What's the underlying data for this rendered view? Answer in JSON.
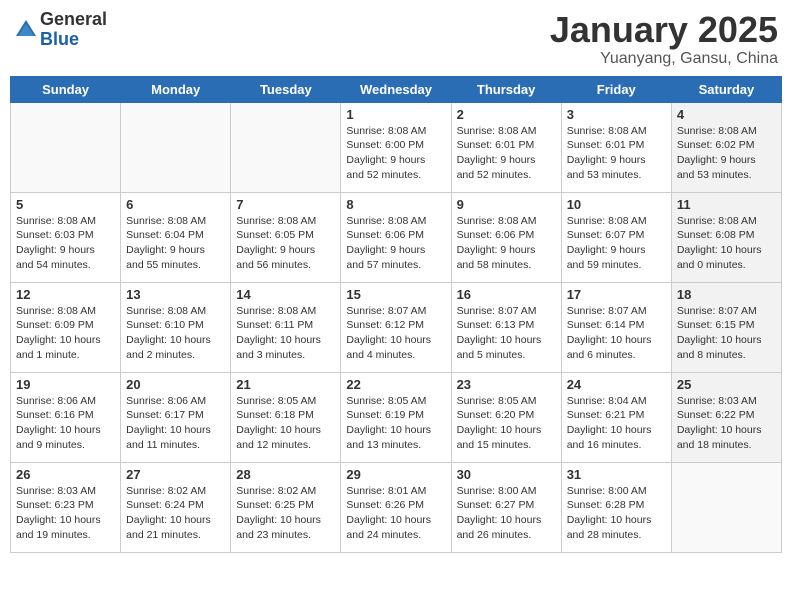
{
  "header": {
    "logo_general": "General",
    "logo_blue": "Blue",
    "title": "January 2025",
    "location": "Yuanyang, Gansu, China"
  },
  "days_of_week": [
    "Sunday",
    "Monday",
    "Tuesday",
    "Wednesday",
    "Thursday",
    "Friday",
    "Saturday"
  ],
  "weeks": [
    [
      {
        "day": "",
        "info": "",
        "shaded": false,
        "empty": true
      },
      {
        "day": "",
        "info": "",
        "shaded": false,
        "empty": true
      },
      {
        "day": "",
        "info": "",
        "shaded": false,
        "empty": true
      },
      {
        "day": "1",
        "info": "Sunrise: 8:08 AM\nSunset: 6:00 PM\nDaylight: 9 hours and 52 minutes.",
        "shaded": false,
        "empty": false
      },
      {
        "day": "2",
        "info": "Sunrise: 8:08 AM\nSunset: 6:01 PM\nDaylight: 9 hours and 52 minutes.",
        "shaded": false,
        "empty": false
      },
      {
        "day": "3",
        "info": "Sunrise: 8:08 AM\nSunset: 6:01 PM\nDaylight: 9 hours and 53 minutes.",
        "shaded": false,
        "empty": false
      },
      {
        "day": "4",
        "info": "Sunrise: 8:08 AM\nSunset: 6:02 PM\nDaylight: 9 hours and 53 minutes.",
        "shaded": true,
        "empty": false
      }
    ],
    [
      {
        "day": "5",
        "info": "Sunrise: 8:08 AM\nSunset: 6:03 PM\nDaylight: 9 hours and 54 minutes.",
        "shaded": false,
        "empty": false
      },
      {
        "day": "6",
        "info": "Sunrise: 8:08 AM\nSunset: 6:04 PM\nDaylight: 9 hours and 55 minutes.",
        "shaded": false,
        "empty": false
      },
      {
        "day": "7",
        "info": "Sunrise: 8:08 AM\nSunset: 6:05 PM\nDaylight: 9 hours and 56 minutes.",
        "shaded": false,
        "empty": false
      },
      {
        "day": "8",
        "info": "Sunrise: 8:08 AM\nSunset: 6:06 PM\nDaylight: 9 hours and 57 minutes.",
        "shaded": false,
        "empty": false
      },
      {
        "day": "9",
        "info": "Sunrise: 8:08 AM\nSunset: 6:06 PM\nDaylight: 9 hours and 58 minutes.",
        "shaded": false,
        "empty": false
      },
      {
        "day": "10",
        "info": "Sunrise: 8:08 AM\nSunset: 6:07 PM\nDaylight: 9 hours and 59 minutes.",
        "shaded": false,
        "empty": false
      },
      {
        "day": "11",
        "info": "Sunrise: 8:08 AM\nSunset: 6:08 PM\nDaylight: 10 hours and 0 minutes.",
        "shaded": true,
        "empty": false
      }
    ],
    [
      {
        "day": "12",
        "info": "Sunrise: 8:08 AM\nSunset: 6:09 PM\nDaylight: 10 hours and 1 minute.",
        "shaded": false,
        "empty": false
      },
      {
        "day": "13",
        "info": "Sunrise: 8:08 AM\nSunset: 6:10 PM\nDaylight: 10 hours and 2 minutes.",
        "shaded": false,
        "empty": false
      },
      {
        "day": "14",
        "info": "Sunrise: 8:08 AM\nSunset: 6:11 PM\nDaylight: 10 hours and 3 minutes.",
        "shaded": false,
        "empty": false
      },
      {
        "day": "15",
        "info": "Sunrise: 8:07 AM\nSunset: 6:12 PM\nDaylight: 10 hours and 4 minutes.",
        "shaded": false,
        "empty": false
      },
      {
        "day": "16",
        "info": "Sunrise: 8:07 AM\nSunset: 6:13 PM\nDaylight: 10 hours and 5 minutes.",
        "shaded": false,
        "empty": false
      },
      {
        "day": "17",
        "info": "Sunrise: 8:07 AM\nSunset: 6:14 PM\nDaylight: 10 hours and 6 minutes.",
        "shaded": false,
        "empty": false
      },
      {
        "day": "18",
        "info": "Sunrise: 8:07 AM\nSunset: 6:15 PM\nDaylight: 10 hours and 8 minutes.",
        "shaded": true,
        "empty": false
      }
    ],
    [
      {
        "day": "19",
        "info": "Sunrise: 8:06 AM\nSunset: 6:16 PM\nDaylight: 10 hours and 9 minutes.",
        "shaded": false,
        "empty": false
      },
      {
        "day": "20",
        "info": "Sunrise: 8:06 AM\nSunset: 6:17 PM\nDaylight: 10 hours and 11 minutes.",
        "shaded": false,
        "empty": false
      },
      {
        "day": "21",
        "info": "Sunrise: 8:05 AM\nSunset: 6:18 PM\nDaylight: 10 hours and 12 minutes.",
        "shaded": false,
        "empty": false
      },
      {
        "day": "22",
        "info": "Sunrise: 8:05 AM\nSunset: 6:19 PM\nDaylight: 10 hours and 13 minutes.",
        "shaded": false,
        "empty": false
      },
      {
        "day": "23",
        "info": "Sunrise: 8:05 AM\nSunset: 6:20 PM\nDaylight: 10 hours and 15 minutes.",
        "shaded": false,
        "empty": false
      },
      {
        "day": "24",
        "info": "Sunrise: 8:04 AM\nSunset: 6:21 PM\nDaylight: 10 hours and 16 minutes.",
        "shaded": false,
        "empty": false
      },
      {
        "day": "25",
        "info": "Sunrise: 8:03 AM\nSunset: 6:22 PM\nDaylight: 10 hours and 18 minutes.",
        "shaded": true,
        "empty": false
      }
    ],
    [
      {
        "day": "26",
        "info": "Sunrise: 8:03 AM\nSunset: 6:23 PM\nDaylight: 10 hours and 19 minutes.",
        "shaded": false,
        "empty": false
      },
      {
        "day": "27",
        "info": "Sunrise: 8:02 AM\nSunset: 6:24 PM\nDaylight: 10 hours and 21 minutes.",
        "shaded": false,
        "empty": false
      },
      {
        "day": "28",
        "info": "Sunrise: 8:02 AM\nSunset: 6:25 PM\nDaylight: 10 hours and 23 minutes.",
        "shaded": false,
        "empty": false
      },
      {
        "day": "29",
        "info": "Sunrise: 8:01 AM\nSunset: 6:26 PM\nDaylight: 10 hours and 24 minutes.",
        "shaded": false,
        "empty": false
      },
      {
        "day": "30",
        "info": "Sunrise: 8:00 AM\nSunset: 6:27 PM\nDaylight: 10 hours and 26 minutes.",
        "shaded": false,
        "empty": false
      },
      {
        "day": "31",
        "info": "Sunrise: 8:00 AM\nSunset: 6:28 PM\nDaylight: 10 hours and 28 minutes.",
        "shaded": false,
        "empty": false
      },
      {
        "day": "",
        "info": "",
        "shaded": true,
        "empty": true
      }
    ]
  ]
}
